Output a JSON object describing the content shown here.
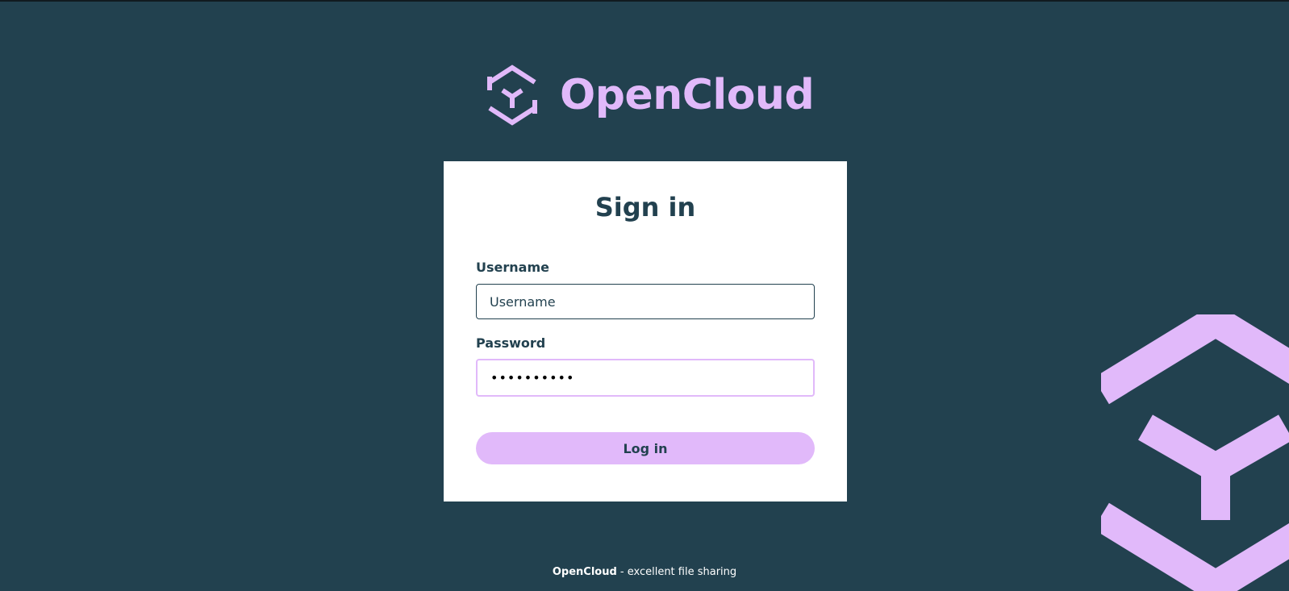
{
  "brand": {
    "name": "OpenCloud",
    "logo_icon": "opencloud-hexagon-icon",
    "accent_color": "#e1b9fa",
    "background_color": "#22414f"
  },
  "login_form": {
    "title": "Sign in",
    "username": {
      "label": "Username",
      "value": "",
      "placeholder": "Username"
    },
    "password": {
      "label": "Password",
      "value": "••••••••••"
    },
    "submit_label": "Log in"
  },
  "footer": {
    "brand": "OpenCloud",
    "tagline": " - excellent file sharing"
  },
  "decoration": {
    "icon": "opencloud-hexagon-background-icon"
  }
}
